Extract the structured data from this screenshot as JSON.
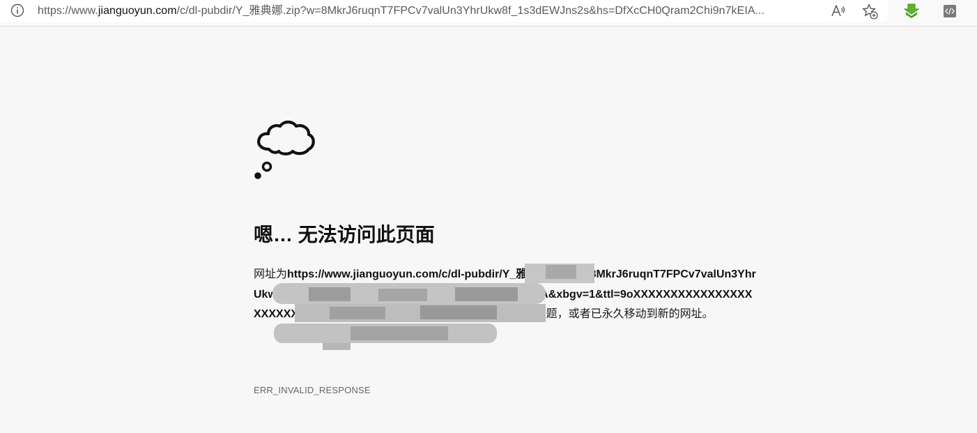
{
  "browser": {
    "address_bar": {
      "url_prefix": "https://www.",
      "url_host": "jianguoyun.com",
      "url_rest": "/c/dl-pubdir/Y_雅典娜.zip?w=8MkrJ6ruqnT7FPCv7valUn3YhrUkw8f_1s3dEWJns2s&hs=DfXcCH0Qram2Chi9n7kEIA..."
    },
    "icons": {
      "info": "info-icon",
      "read_aloud": "read-aloud-icon",
      "favorites": "add-favorite-icon",
      "download_ext": "download-extension-icon",
      "dev_ext": "developer-extension-icon"
    }
  },
  "error_page": {
    "icon": "thought-cloud-icon",
    "title": "嗯… 无法访问此页面",
    "description_prefix": "网址为",
    "description_url": "https://www.jianguoyun.com/c/dl-pubdir/Y_雅典娜.zip?w=8MkrJ6ruqnT7FPCv7valUn3YhrUkw8f_1s3dEWJns2s&hs=DfXcCH0Qram2Chi9n7kEIAA&xbgv=1&ttl=9oXXXXXXXXXXXXXXXXXXXXXXXXXXXXXXXc0QHFxLmNvbQ",
    "description_suffix": " 的页面可能存在问题，或者已永久移动到新的网址。",
    "error_code": "ERR_INVALID_RESPONSE"
  },
  "colors": {
    "page_background": "#f7f7f7",
    "title_text": "#111111",
    "code_text": "#666666",
    "download_green": "#4caf1a"
  }
}
